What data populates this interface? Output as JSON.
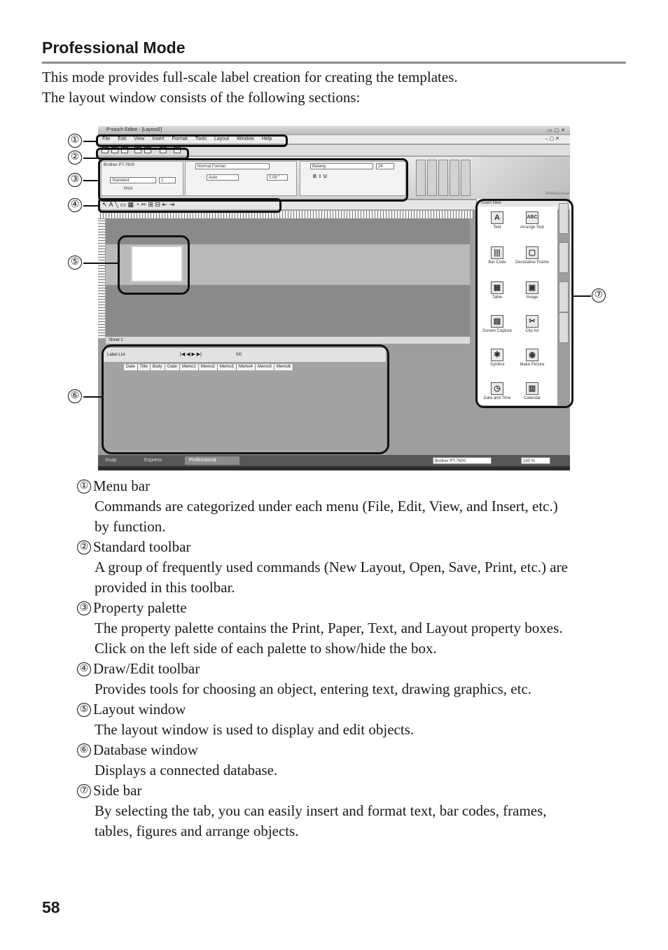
{
  "heading": "Professional Mode",
  "intro": [
    "This mode provides full-scale label creation for creating the templates.",
    "The layout window consists of the following sections:"
  ],
  "screenshot": {
    "title": "P-touch Editor - [Layout2]",
    "menu": [
      "File",
      "Edit",
      "View",
      "Insert",
      "Format",
      "Tools",
      "Layout",
      "Window",
      "Help"
    ],
    "printer": "Brother PT-7600",
    "paper_field": "Standard",
    "copies_field": "1",
    "print_button": "Print",
    "format_field": "Normal Format",
    "length_field": "Auto",
    "margin_field": "0.08 \"",
    "font_field": "Batang",
    "size_field": "24",
    "brand_text": "Professional",
    "sheet_tab": "Sheet 1",
    "db_title": "Label List",
    "db_count": "0/0",
    "db_columns": [
      "Date",
      "Title",
      "Body",
      "Code",
      "Memo1",
      "Memo2",
      "Memo3",
      "Memo4",
      "Memo5",
      "Memo6"
    ],
    "side_header": "Insert New",
    "side_items": [
      {
        "label": "Text",
        "icon": "A"
      },
      {
        "label": "Arrange Text",
        "icon": "ABC"
      },
      {
        "label": "Bar Code",
        "icon": "|||"
      },
      {
        "label": "Decorative Frame",
        "icon": "▢"
      },
      {
        "label": "Table",
        "icon": "▦"
      },
      {
        "label": "Image",
        "icon": "▣"
      },
      {
        "label": "Screen Capture",
        "icon": "▤"
      },
      {
        "label": "Clip Art",
        "icon": "✂"
      },
      {
        "label": "Symbol",
        "icon": "✱"
      },
      {
        "label": "Make Picture",
        "icon": "◉"
      },
      {
        "label": "Date and Time",
        "icon": "◷"
      },
      {
        "label": "Calendar",
        "icon": "▥"
      }
    ],
    "status_snap": "Snap",
    "status_express": "Express",
    "status_professional": "Professional",
    "status_printer": "Brother PT-7600",
    "status_zoom": "100 %"
  },
  "callouts": [
    "①",
    "②",
    "③",
    "④",
    "⑤",
    "⑥",
    "⑦"
  ],
  "sections": [
    {
      "num": "①",
      "title": "Menu bar",
      "body": [
        "Commands are categorized under each menu (File, Edit, View, and Insert, etc.)",
        "by function."
      ]
    },
    {
      "num": "②",
      "title": "Standard toolbar",
      "body": [
        "A group of frequently used commands (New Layout, Open, Save, Print, etc.) are",
        "provided in this toolbar."
      ]
    },
    {
      "num": "③",
      "title": "Property palette",
      "body": [
        "The property palette contains the Print, Paper, Text, and Layout property boxes.",
        "Click on the left side of each palette to show/hide the box."
      ]
    },
    {
      "num": "④",
      "title": "Draw/Edit toolbar",
      "body": [
        "Provides tools for choosing an object, entering text, drawing graphics, etc."
      ]
    },
    {
      "num": "⑤",
      "title": "Layout window",
      "body": [
        "The layout window is used to display and edit objects."
      ]
    },
    {
      "num": "⑥",
      "title": "Database window",
      "body": [
        "Displays a connected database."
      ]
    },
    {
      "num": "⑦",
      "title": "Side bar",
      "body": [
        "By selecting the tab, you can easily insert and format text, bar codes, frames,",
        "tables, figures and arrange objects."
      ]
    }
  ],
  "page_number": "58"
}
